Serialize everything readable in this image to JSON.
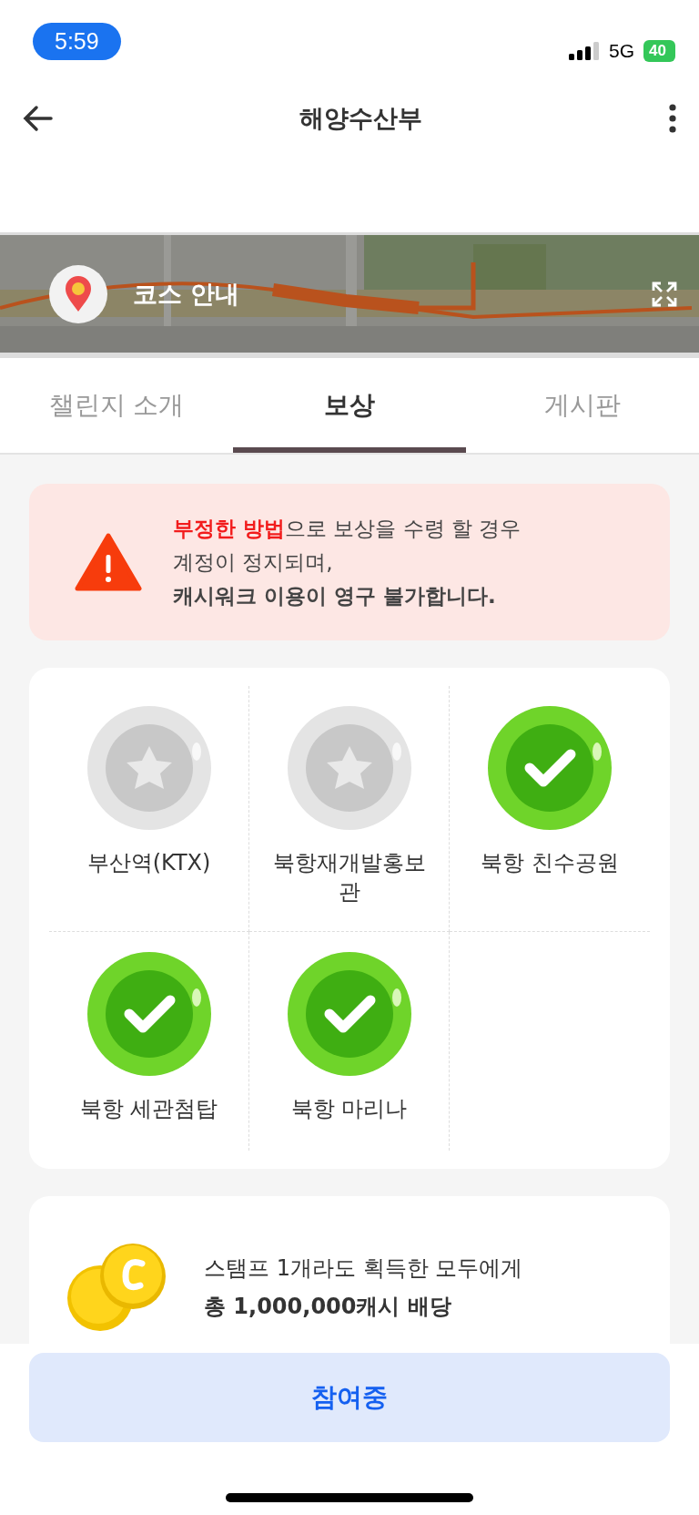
{
  "status_bar": {
    "time": "5:59",
    "network": "5G",
    "battery": "40"
  },
  "header": {
    "title": "해양수산부"
  },
  "map": {
    "label": "코스 안내"
  },
  "tabs": [
    {
      "label": "챌린지 소개",
      "selected": false
    },
    {
      "label": "보상",
      "selected": true
    },
    {
      "label": "게시판",
      "selected": false
    }
  ],
  "warning": {
    "lines": [
      "**부정한 방법**으로 보상을 수령 할 경우",
      "계정이 정지되며,",
      "캐시워크 이용이 영구 불가합니다."
    ]
  },
  "stamps": [
    {
      "name": "부산역(KTX)",
      "collected": false
    },
    {
      "name": "북항재개발홍보관",
      "collected": false
    },
    {
      "name": "북항 친수공원",
      "collected": true
    },
    {
      "name": "북항 세관첨탑",
      "collected": true
    },
    {
      "name": "북항 마리나",
      "collected": true
    }
  ],
  "reward": {
    "line": "스탬프 1개라도 획득한 모두에게",
    "amount": "총 1,000,000캐시 배당"
  },
  "action_button": {
    "label": "참여중"
  }
}
